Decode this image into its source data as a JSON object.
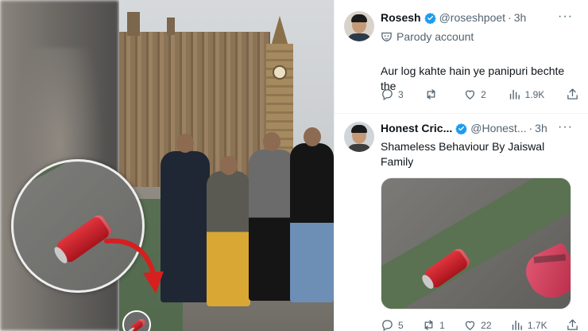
{
  "tweets": [
    {
      "name": "Rosesh",
      "handle": "@roseshpoet",
      "separator": "·",
      "time": "3h",
      "more": "···",
      "label": "Parody account",
      "text": "Aur log kahte hain ye panipuri bechte the",
      "stats": {
        "replies": "3",
        "reposts": "",
        "likes": "2",
        "views": "1.9K"
      }
    },
    {
      "name": "Honest Cric...",
      "handle": "@Honest...",
      "separator": "·",
      "time": "3h",
      "more": "···",
      "text": "Shameless Behaviour By Jaiswal Family",
      "stats": {
        "replies": "5",
        "reposts": "1",
        "likes": "22",
        "views": "1.7K"
      }
    }
  ],
  "colors": {
    "verified_blue": "#1d9bf0",
    "muted_text": "#536471",
    "can_red": "#d2232d",
    "arrow_red": "#d61f1f"
  },
  "icons": [
    "verified-badge-icon",
    "parody-mask-icon",
    "more-icon",
    "reply-icon",
    "repost-icon",
    "like-icon",
    "views-icon",
    "share-icon",
    "red-arrow-icon"
  ]
}
